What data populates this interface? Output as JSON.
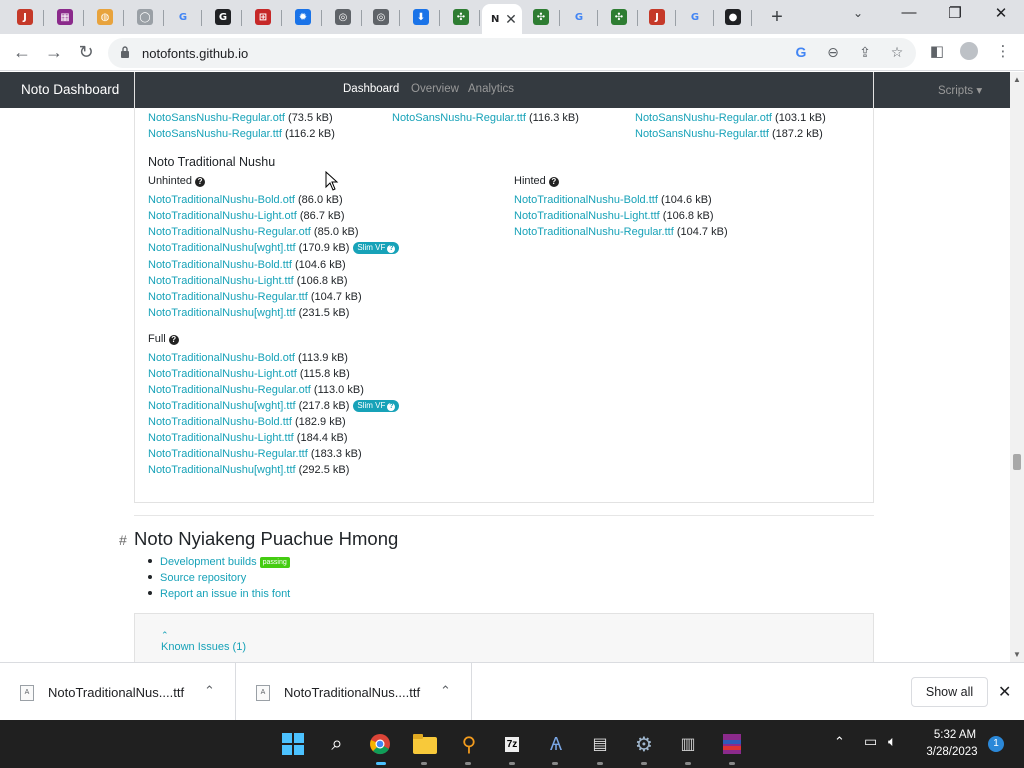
{
  "browser": {
    "tabs": [
      {
        "icon": "bookmark-app-icon",
        "color": "#c53929",
        "glyph": "J"
      },
      {
        "icon": "winrar-icon",
        "color": "#8b2a8b",
        "glyph": "▦"
      },
      {
        "icon": "pizza-icon",
        "color": "#e8a33d",
        "glyph": "◍"
      },
      {
        "icon": "github-icon",
        "color": "#9aa0a6",
        "glyph": "◯"
      },
      {
        "icon": "google-icon",
        "color": "#ffffff",
        "glyph": "G"
      },
      {
        "icon": "g-letter-icon",
        "color": "#202124",
        "glyph": "G"
      },
      {
        "icon": "unicode-icon",
        "color": "#c62828",
        "glyph": "⊞"
      },
      {
        "icon": "settings-icon",
        "color": "#1a73e8",
        "glyph": "✹"
      },
      {
        "icon": "chrome-icon",
        "color": "#5f6368",
        "glyph": "◎"
      },
      {
        "icon": "chrome-icon",
        "color": "#5f6368",
        "glyph": "◎"
      },
      {
        "icon": "download-icon",
        "color": "#1a73e8",
        "glyph": "⬇"
      },
      {
        "icon": "puzzle-icon",
        "color": "#2e7d32",
        "glyph": "✣"
      },
      {
        "icon": "noto-tab-icon",
        "color": "#ffffff",
        "glyph": "N",
        "active": true
      },
      {
        "icon": "puzzle-icon",
        "color": "#2e7d32",
        "glyph": "✣"
      },
      {
        "icon": "google-icon",
        "color": "#ffffff",
        "glyph": "G"
      },
      {
        "icon": "puzzle-icon",
        "color": "#2e7d32",
        "glyph": "✣"
      },
      {
        "icon": "bookmark-app-icon",
        "color": "#c53929",
        "glyph": "J"
      },
      {
        "icon": "google-icon",
        "color": "#ffffff",
        "glyph": "G"
      },
      {
        "icon": "globe-icon",
        "color": "#202124",
        "glyph": "●"
      }
    ],
    "active_tab_label": "N",
    "new_tab_glyph": "+",
    "url": "notofonts.github.io"
  },
  "page": {
    "brand": "Noto Dashboard",
    "nav": {
      "dashboard": "Dashboard",
      "overview": "Overview",
      "analytics": "Analytics",
      "scripts": "Scripts ▾"
    },
    "top_rows": [
      [
        {
          "name": "NotoSansNushu-Regular.otf",
          "size": "(73.5 kB)"
        },
        {
          "name": "NotoSansNushu-Regular.ttf",
          "size": "(116.3 kB)"
        },
        {
          "name": "NotoSansNushu-Regular.otf",
          "size": "(103.1 kB)"
        }
      ],
      [
        {
          "name": "NotoSansNushu-Regular.ttf",
          "size": "(116.2 kB)"
        },
        null,
        {
          "name": "NotoSansNushu-Regular.ttf",
          "size": "(187.2 kB)"
        }
      ]
    ],
    "traditional": {
      "title": "Noto Traditional Nushu",
      "unhinted_label": "Unhinted",
      "hinted_label": "Hinted",
      "full_label": "Full",
      "slim_badge": "Slim VF",
      "unhinted": [
        {
          "name": "NotoTraditionalNushu-Bold.otf",
          "size": "(86.0 kB)"
        },
        {
          "name": "NotoTraditionalNushu-Light.otf",
          "size": "(86.7 kB)"
        },
        {
          "name": "NotoTraditionalNushu-Regular.otf",
          "size": "(85.0 kB)"
        },
        {
          "name": "NotoTraditionalNushu[wght].ttf",
          "size": "(170.9 kB)",
          "slim": true
        },
        {
          "name": "NotoTraditionalNushu-Bold.ttf",
          "size": "(104.6 kB)"
        },
        {
          "name": "NotoTraditionalNushu-Light.ttf",
          "size": "(106.8 kB)"
        },
        {
          "name": "NotoTraditionalNushu-Regular.ttf",
          "size": "(104.7 kB)"
        },
        {
          "name": "NotoTraditionalNushu[wght].ttf",
          "size": "(231.5 kB)"
        }
      ],
      "hinted": [
        {
          "name": "NotoTraditionalNushu-Bold.ttf",
          "size": "(104.6 kB)"
        },
        {
          "name": "NotoTraditionalNushu-Light.ttf",
          "size": "(106.8 kB)"
        },
        {
          "name": "NotoTraditionalNushu-Regular.ttf",
          "size": "(104.7 kB)"
        }
      ],
      "full": [
        {
          "name": "NotoTraditionalNushu-Bold.otf",
          "size": "(113.9 kB)"
        },
        {
          "name": "NotoTraditionalNushu-Light.otf",
          "size": "(115.8 kB)"
        },
        {
          "name": "NotoTraditionalNushu-Regular.otf",
          "size": "(113.0 kB)"
        },
        {
          "name": "NotoTraditionalNushu[wght].ttf",
          "size": "(217.8 kB)",
          "slim": true
        },
        {
          "name": "NotoTraditionalNushu-Bold.ttf",
          "size": "(182.9 kB)"
        },
        {
          "name": "NotoTraditionalNushu-Light.ttf",
          "size": "(184.4 kB)"
        },
        {
          "name": "NotoTraditionalNushu-Regular.ttf",
          "size": "(183.3 kB)"
        },
        {
          "name": "NotoTraditionalNushu[wght].ttf",
          "size": "(292.5 kB)"
        }
      ]
    },
    "next_section": {
      "hash": "#",
      "title": "Noto Nyiakeng Puachue Hmong",
      "links": [
        "Development builds",
        "Source repository",
        "Report an issue in this font"
      ],
      "passing_badge": "passing",
      "known_issues": "Known Issues (1)"
    }
  },
  "downloads": {
    "items": [
      "NotoTraditionalNus....ttf",
      "NotoTraditionalNus....ttf"
    ],
    "show_all": "Show all"
  },
  "taskbar": {
    "time": "5:32 AM",
    "date": "3/28/2023",
    "notifications": "1"
  }
}
